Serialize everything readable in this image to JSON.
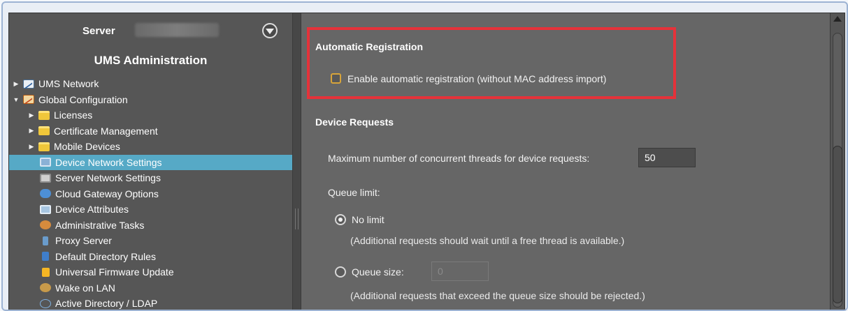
{
  "server_header": {
    "server_label": "Server",
    "title": "UMS Administration"
  },
  "tree": [
    {
      "label": "UMS Network",
      "icon": "ums-network-icon",
      "level": 0,
      "expander": "collapsed"
    },
    {
      "label": "Global Configuration",
      "icon": "global-configuration-icon",
      "level": 0,
      "expander": "expanded"
    },
    {
      "label": "Licenses",
      "icon": "folder-icon",
      "level": 1,
      "expander": "collapsed"
    },
    {
      "label": "Certificate Management",
      "icon": "folder-icon",
      "level": 1,
      "expander": "collapsed"
    },
    {
      "label": "Mobile Devices",
      "icon": "folder-icon",
      "level": 1,
      "expander": "collapsed"
    },
    {
      "label": "Device Network Settings",
      "icon": "monitor-icon",
      "level": 2,
      "selected": true
    },
    {
      "label": "Server Network Settings",
      "icon": "server-icon",
      "level": 2
    },
    {
      "label": "Cloud Gateway Options",
      "icon": "cloud-icon",
      "level": 2
    },
    {
      "label": "Device Attributes",
      "icon": "attributes-icon",
      "level": 2
    },
    {
      "label": "Administrative Tasks",
      "icon": "task-icon",
      "level": 2
    },
    {
      "label": "Proxy Server",
      "icon": "proxy-icon",
      "level": 2
    },
    {
      "label": "Default Directory Rules",
      "icon": "rules-icon",
      "level": 2
    },
    {
      "label": "Universal Firmware Update",
      "icon": "firmware-icon",
      "level": 2
    },
    {
      "label": "Wake on LAN",
      "icon": "wake-on-lan-icon",
      "level": 2
    },
    {
      "label": "Active Directory / LDAP",
      "icon": "ldap-icon",
      "level": 2
    }
  ],
  "auto_registration": {
    "title": "Automatic Registration",
    "checkbox_label": "Enable automatic registration (without MAC address import)",
    "checked": false
  },
  "device_requests": {
    "title": "Device Requests",
    "max_threads_label": "Maximum number of concurrent threads for device requests:",
    "max_threads_value": "50",
    "queue_limit_label": "Queue limit:",
    "no_limit_label": "No limit",
    "no_limit_note": "(Additional requests should wait until a free thread is available.)",
    "queue_size_label": "Queue size:",
    "queue_size_value": "0",
    "queue_size_note": "(Additional requests that exceed the queue size should be rejected.)",
    "selected_option": "No limit"
  },
  "colors": {
    "selected_row": "#56a9c6",
    "highlight_border": "#e5323a",
    "checkbox_border": "#d7a43a"
  }
}
